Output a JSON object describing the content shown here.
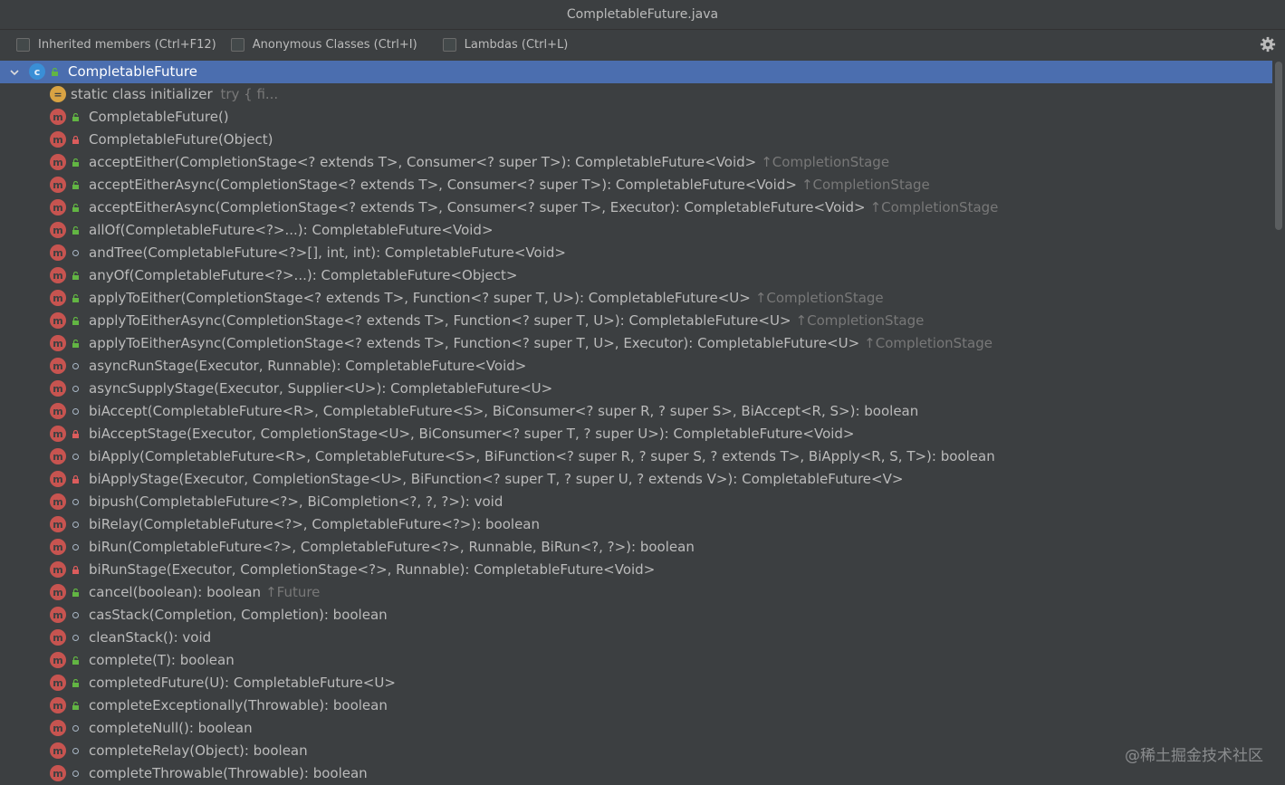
{
  "window": {
    "title": "CompletableFuture.java"
  },
  "toolbar": {
    "checkboxes": [
      {
        "label": "Inherited members (Ctrl+F12)",
        "checked": false
      },
      {
        "label": "Anonymous Classes (Ctrl+I)",
        "checked": false
      },
      {
        "label": "Lambdas (Ctrl+L)",
        "checked": false
      }
    ],
    "settings_icon": "gear-icon"
  },
  "tree": {
    "root": {
      "label": "CompletableFuture",
      "icon": "class-icon",
      "expanded": true,
      "selected": true
    },
    "initializer": {
      "label": "static class initializer",
      "hint": "try {           fi..."
    },
    "members": [
      {
        "text": "CompletableFuture()",
        "vis": "pub",
        "inherited": ""
      },
      {
        "text": "CompletableFuture(Object)",
        "vis": "priv",
        "inherited": ""
      },
      {
        "text": "acceptEither(CompletionStage<? extends T>, Consumer<? super T>): CompletableFuture<Void>",
        "vis": "pub",
        "inherited": "↑CompletionStage"
      },
      {
        "text": "acceptEitherAsync(CompletionStage<? extends T>, Consumer<? super T>): CompletableFuture<Void>",
        "vis": "pub",
        "inherited": "↑CompletionStage"
      },
      {
        "text": "acceptEitherAsync(CompletionStage<? extends T>, Consumer<? super T>, Executor): CompletableFuture<Void>",
        "vis": "pub",
        "inherited": "↑CompletionStage"
      },
      {
        "text": "allOf(CompletableFuture<?>...): CompletableFuture<Void>",
        "vis": "pub",
        "inherited": ""
      },
      {
        "text": "andTree(CompletableFuture<?>[], int, int): CompletableFuture<Void>",
        "vis": "pkg",
        "inherited": ""
      },
      {
        "text": "anyOf(CompletableFuture<?>...): CompletableFuture<Object>",
        "vis": "pub",
        "inherited": ""
      },
      {
        "text": "applyToEither(CompletionStage<? extends T>, Function<? super T, U>): CompletableFuture<U>",
        "vis": "pub",
        "inherited": "↑CompletionStage"
      },
      {
        "text": "applyToEitherAsync(CompletionStage<? extends T>, Function<? super T, U>): CompletableFuture<U>",
        "vis": "pub",
        "inherited": "↑CompletionStage"
      },
      {
        "text": "applyToEitherAsync(CompletionStage<? extends T>, Function<? super T, U>, Executor): CompletableFuture<U>",
        "vis": "pub",
        "inherited": "↑CompletionStage"
      },
      {
        "text": "asyncRunStage(Executor, Runnable): CompletableFuture<Void>",
        "vis": "pkg",
        "inherited": ""
      },
      {
        "text": "asyncSupplyStage(Executor, Supplier<U>): CompletableFuture<U>",
        "vis": "pkg",
        "inherited": ""
      },
      {
        "text": "biAccept(CompletableFuture<R>, CompletableFuture<S>, BiConsumer<? super R, ? super S>, BiAccept<R, S>): boolean",
        "vis": "pkg",
        "inherited": ""
      },
      {
        "text": "biAcceptStage(Executor, CompletionStage<U>, BiConsumer<? super T, ? super U>): CompletableFuture<Void>",
        "vis": "priv",
        "inherited": ""
      },
      {
        "text": "biApply(CompletableFuture<R>, CompletableFuture<S>, BiFunction<? super R, ? super S, ? extends T>, BiApply<R, S, T>): boolean",
        "vis": "pkg",
        "inherited": ""
      },
      {
        "text": "biApplyStage(Executor, CompletionStage<U>, BiFunction<? super T, ? super U, ? extends V>): CompletableFuture<V>",
        "vis": "priv",
        "inherited": ""
      },
      {
        "text": "bipush(CompletableFuture<?>, BiCompletion<?, ?, ?>): void",
        "vis": "pkg",
        "inherited": ""
      },
      {
        "text": "biRelay(CompletableFuture<?>, CompletableFuture<?>): boolean",
        "vis": "pkg",
        "inherited": ""
      },
      {
        "text": "biRun(CompletableFuture<?>, CompletableFuture<?>, Runnable, BiRun<?, ?>): boolean",
        "vis": "pkg",
        "inherited": ""
      },
      {
        "text": "biRunStage(Executor, CompletionStage<?>, Runnable): CompletableFuture<Void>",
        "vis": "priv",
        "inherited": ""
      },
      {
        "text": "cancel(boolean): boolean",
        "vis": "pub",
        "inherited": "↑Future"
      },
      {
        "text": "casStack(Completion, Completion): boolean",
        "vis": "pkg",
        "inherited": ""
      },
      {
        "text": "cleanStack(): void",
        "vis": "pkg",
        "inherited": ""
      },
      {
        "text": "complete(T): boolean",
        "vis": "pub",
        "inherited": ""
      },
      {
        "text": "completedFuture(U): CompletableFuture<U>",
        "vis": "pub",
        "inherited": ""
      },
      {
        "text": "completeExceptionally(Throwable): boolean",
        "vis": "pub",
        "inherited": ""
      },
      {
        "text": "completeNull(): boolean",
        "vis": "pkg",
        "inherited": ""
      },
      {
        "text": "completeRelay(Object): boolean",
        "vis": "pkg",
        "inherited": ""
      },
      {
        "text": "completeThrowable(Throwable): boolean",
        "vis": "pkg",
        "inherited": ""
      }
    ]
  },
  "watermark": "@稀土掘金技术社区",
  "colors": {
    "selection": "#4b6eaf",
    "method_icon": "#c75450",
    "class_icon": "#3a8fd6",
    "public": "#62b543",
    "private": "#db5c5c"
  }
}
